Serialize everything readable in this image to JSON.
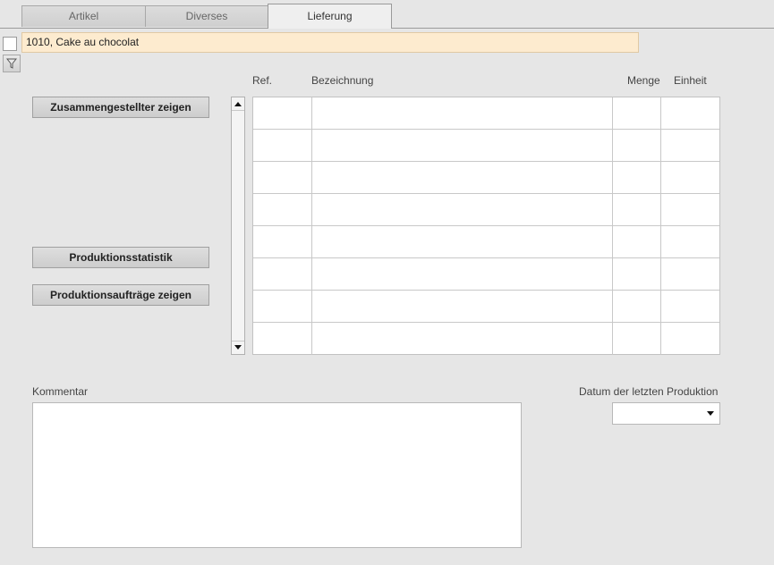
{
  "tabs": [
    {
      "label": "Artikel",
      "active": false
    },
    {
      "label": "Diverses",
      "active": false
    },
    {
      "label": "Lieferung",
      "active": true
    }
  ],
  "record": {
    "value": "1010, Cake au chocolat",
    "checked": false
  },
  "buttons": {
    "assembled": "Zusammengestellter zeigen",
    "statistics": "Produktionsstatistik",
    "orders": "Produktionsaufträge zeigen"
  },
  "table": {
    "columns": [
      "Ref.",
      "Bezeichnung",
      "Menge",
      "Einheit"
    ],
    "rows": [
      [
        "",
        "",
        "",
        ""
      ],
      [
        "",
        "",
        "",
        ""
      ],
      [
        "",
        "",
        "",
        ""
      ],
      [
        "",
        "",
        "",
        ""
      ],
      [
        "",
        "",
        "",
        ""
      ],
      [
        "",
        "",
        "",
        ""
      ],
      [
        "",
        "",
        "",
        ""
      ],
      [
        "",
        "",
        "",
        ""
      ]
    ]
  },
  "comment": {
    "label": "Kommentar",
    "value": ""
  },
  "last_production": {
    "label": "Datum der letzten Produktion",
    "value": ""
  },
  "icons": {
    "filter": "filter-icon",
    "scroll_up": "arrow-up-icon",
    "scroll_down": "arrow-down-icon",
    "dropdown": "chevron-down-icon"
  },
  "colors": {
    "record_field_bg": "#fdebcf",
    "background": "#e6e6e6"
  }
}
